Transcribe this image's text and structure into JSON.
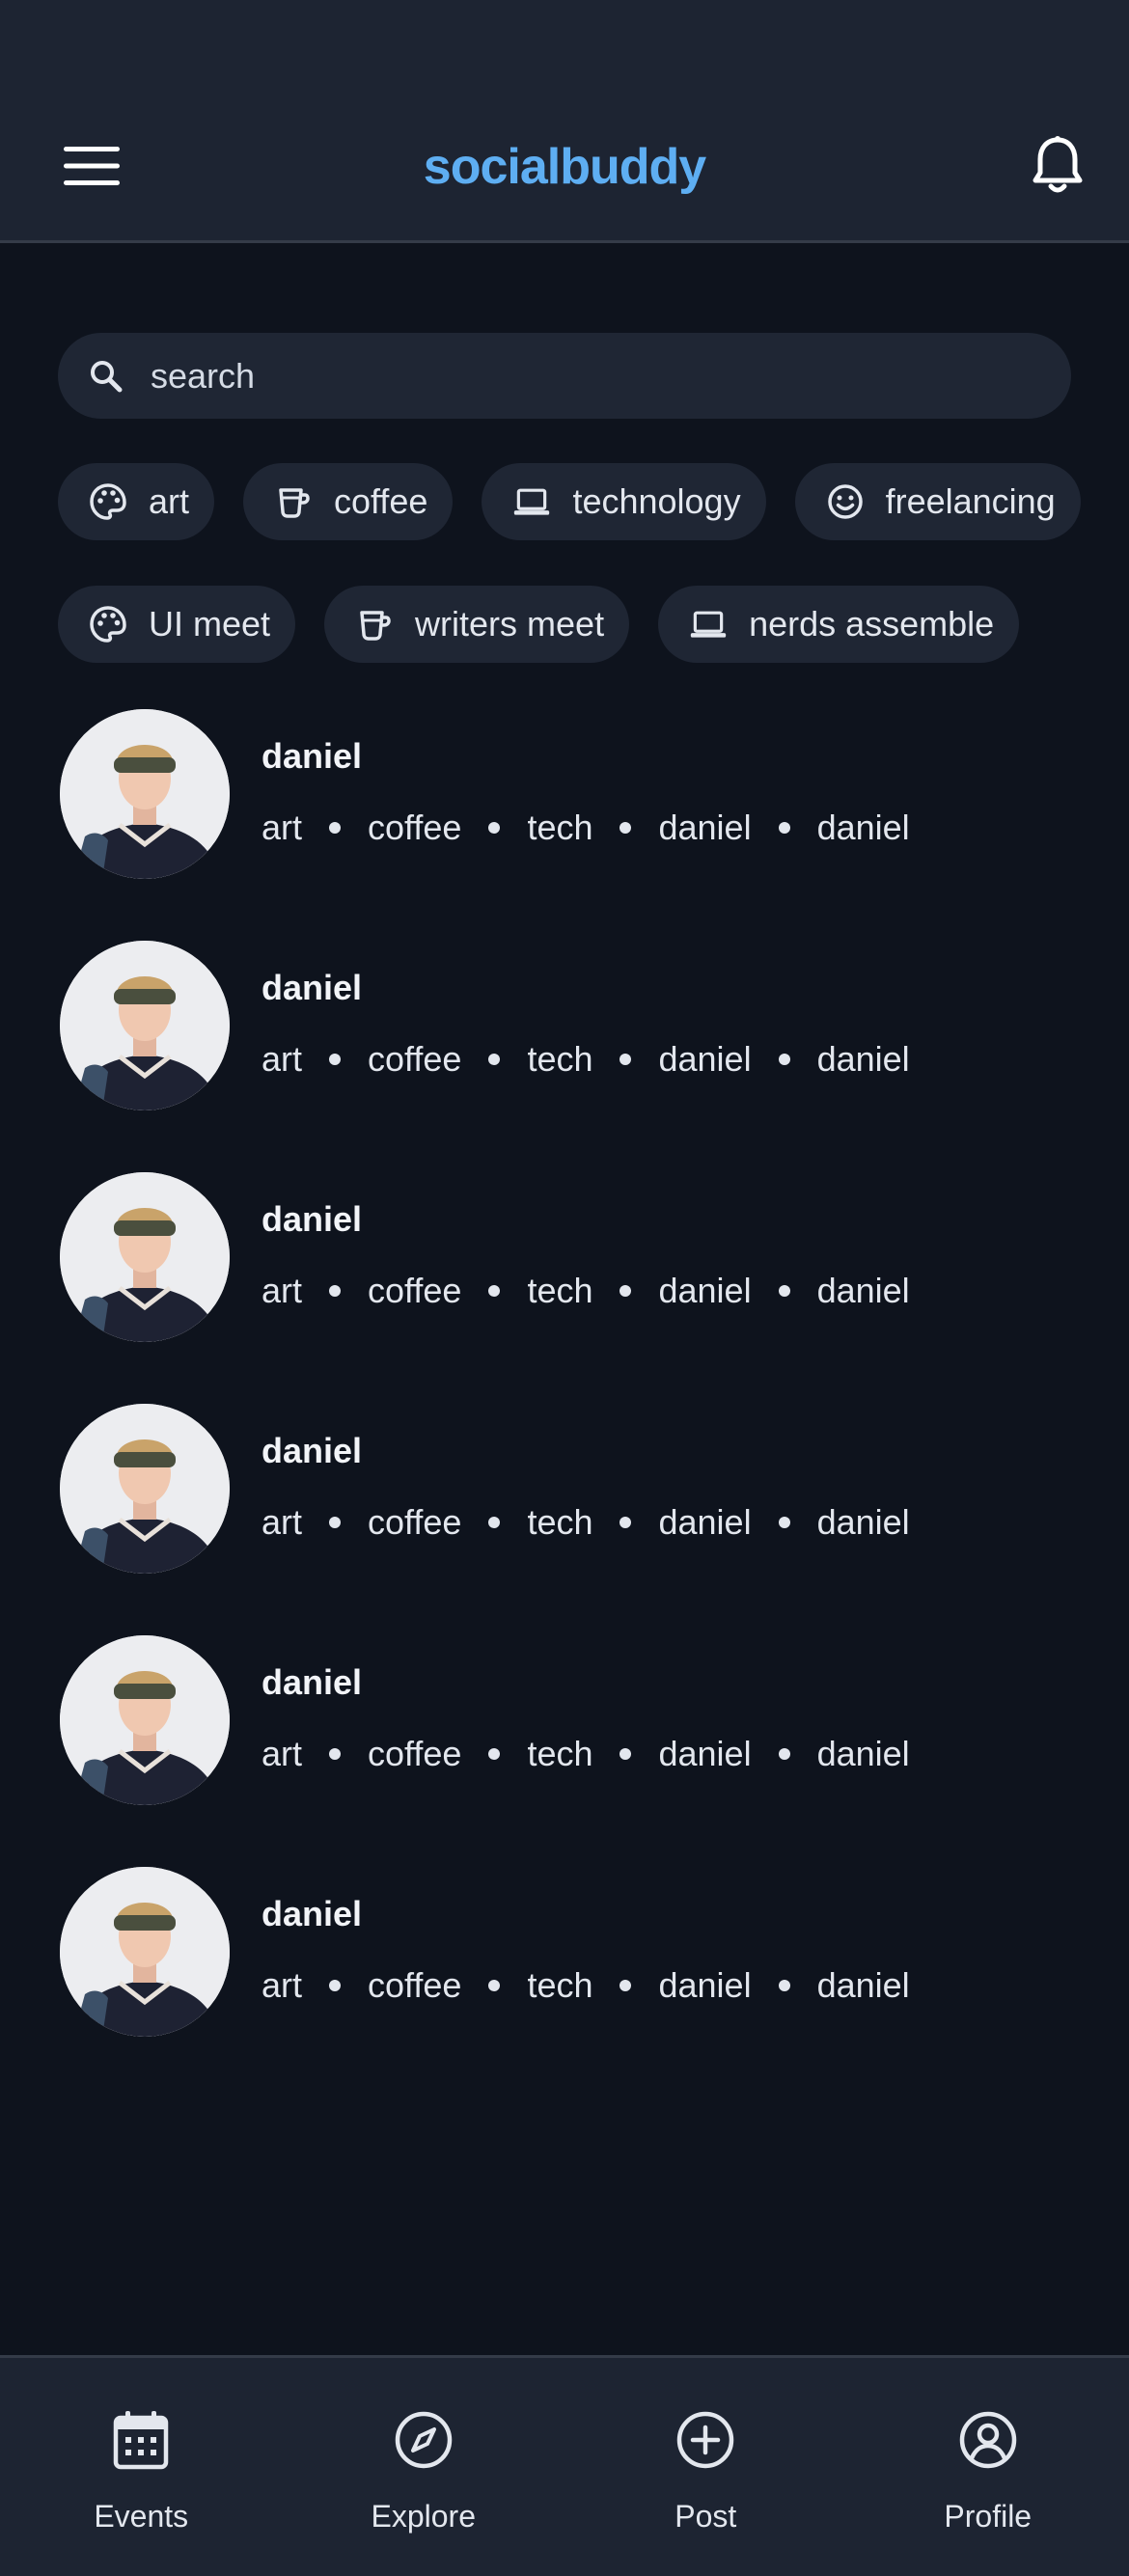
{
  "header": {
    "title": "socialbuddy",
    "menu_icon": "hamburger-menu-icon",
    "bell_icon": "bell-icon"
  },
  "colors": {
    "accent": "#5eaef2",
    "background": "#0e131d",
    "surface": "#1d2432",
    "chip": "#1f2634"
  },
  "search": {
    "placeholder": "search",
    "value": "",
    "icon": "search-icon"
  },
  "chips_row1": [
    {
      "label": "art",
      "icon": "palette-icon"
    },
    {
      "label": "coffee",
      "icon": "coffee-cup-icon"
    },
    {
      "label": "technology",
      "icon": "laptop-icon"
    },
    {
      "label": "freelancing",
      "icon": "smiley-icon"
    }
  ],
  "chips_row2": [
    {
      "label": "UI meet",
      "icon": "palette-icon"
    },
    {
      "label": "writers meet",
      "icon": "coffee-cup-icon"
    },
    {
      "label": "nerds assemble",
      "icon": "laptop-icon"
    }
  ],
  "people": [
    {
      "name": "daniel",
      "tags": [
        "art",
        "coffee",
        "tech",
        "daniel",
        "daniel"
      ]
    },
    {
      "name": "daniel",
      "tags": [
        "art",
        "coffee",
        "tech",
        "daniel",
        "daniel"
      ]
    },
    {
      "name": "daniel",
      "tags": [
        "art",
        "coffee",
        "tech",
        "daniel",
        "daniel"
      ]
    },
    {
      "name": "daniel",
      "tags": [
        "art",
        "coffee",
        "tech",
        "daniel",
        "daniel"
      ]
    },
    {
      "name": "daniel",
      "tags": [
        "art",
        "coffee",
        "tech",
        "daniel",
        "daniel"
      ]
    },
    {
      "name": "daniel",
      "tags": [
        "art",
        "coffee",
        "tech",
        "daniel",
        "daniel"
      ]
    }
  ],
  "nav": [
    {
      "label": "Events",
      "icon": "calendar-icon"
    },
    {
      "label": "Explore",
      "icon": "compass-icon"
    },
    {
      "label": "Post",
      "icon": "plus-circle-icon"
    },
    {
      "label": "Profile",
      "icon": "user-circle-icon"
    }
  ]
}
